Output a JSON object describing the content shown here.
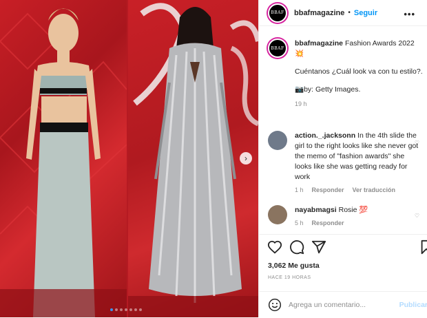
{
  "post": {
    "username": "bbafmagazine",
    "avatar_text": "BBAF",
    "follow_label": "Seguir",
    "separator": "•",
    "more_label": "•••",
    "caption_line1": "Fashion Awards 2022",
    "caption_emoji1": "💥",
    "caption_line2": "Cuéntanos ¿Cuál look va con tu estilo?.",
    "caption_line3": "📷by: Getty Images.",
    "caption_time": "19 h"
  },
  "comments": [
    {
      "username": "action._.jacksonn",
      "text": "In the 4th slide the girl to the right looks like she never got the memo of \"fashion awards\" she looks like she was getting ready for work",
      "time": "1 h",
      "reply_label": "Responder",
      "translate_label": "Ver traducción",
      "avatar_color": "#6f7a8a"
    },
    {
      "username": "nayabmagsi",
      "text": "Rosie 💯",
      "time": "5 h",
      "reply_label": "Responder",
      "avatar_color": "#8a7460"
    }
  ],
  "likes_text": "3,062 Me gusta",
  "time_ago": "HACE 19 HORAS",
  "add_comment": {
    "placeholder": "Agrega un comentario...",
    "post_label": "Publicar"
  },
  "icons": {
    "like": "heart-icon",
    "comment": "comment-icon",
    "share": "paper-plane-icon",
    "save": "bookmark-icon",
    "emoji": "smiley-icon",
    "next": "chevron-right-icon"
  },
  "carousel": {
    "slide_count": 7,
    "active_index": 0
  },
  "colors": {
    "accent": "#0095f6",
    "background_red": "#c81f26"
  }
}
